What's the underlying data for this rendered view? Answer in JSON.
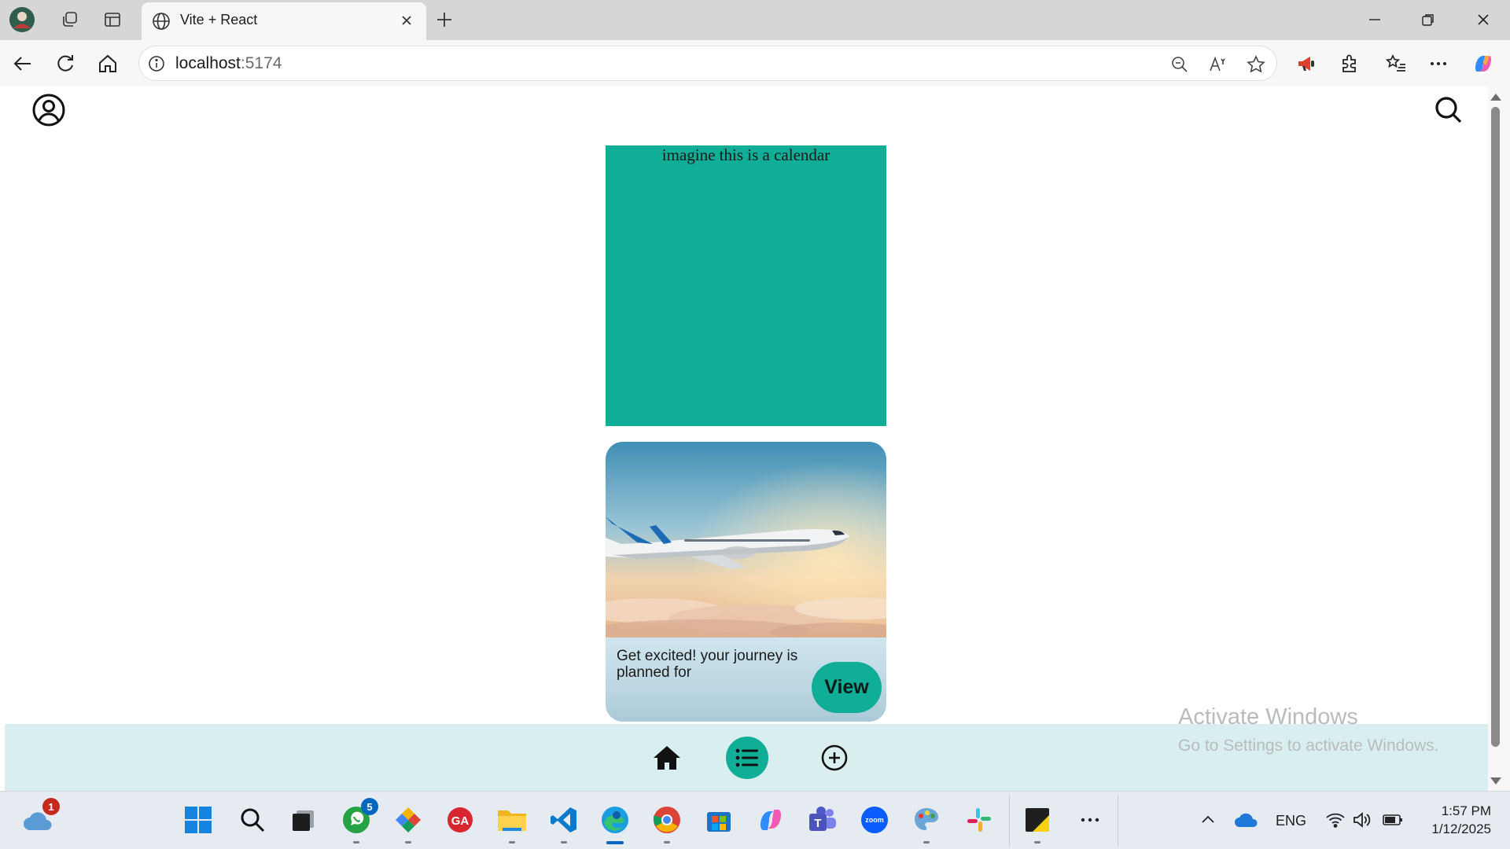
{
  "browser": {
    "tab_title": "Vite + React",
    "url_host": "localhost",
    "url_port": ":5174"
  },
  "page": {
    "calendar_text": "imagine this is a calendar",
    "card": {
      "caption": "Get excited! your journey is planned for",
      "button_label": "View"
    },
    "accent_color": "#10ad97",
    "bottom_nav_color": "#d9eeee"
  },
  "watermark": {
    "title": "Activate Windows",
    "subtitle": "Go to Settings to activate Windows."
  },
  "taskbar": {
    "weather_badge": "1",
    "whatsapp_badge": "5",
    "language": "ENG",
    "time": "1:57 PM",
    "date": "1/12/2025"
  }
}
